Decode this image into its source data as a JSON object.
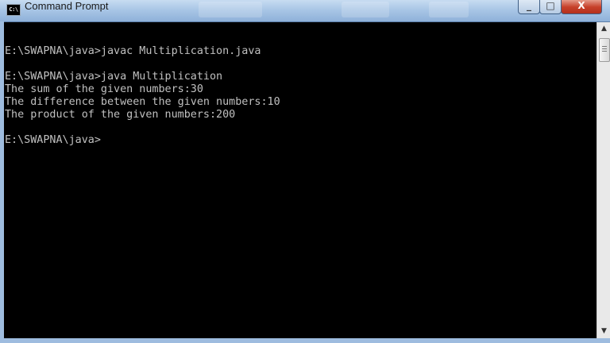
{
  "window": {
    "title": "Command Prompt",
    "icon_text": "C:\\",
    "controls": {
      "minimize_icon": "minimize-icon",
      "maximize_icon": "maximize-icon",
      "close_icon": "close-icon"
    }
  },
  "console": {
    "lines": [
      "",
      "E:\\SWAPNA\\java>javac Multiplication.java",
      "",
      "E:\\SWAPNA\\java>java Multiplication",
      "The sum of the given numbers:30",
      "The difference between the given numbers:10",
      "The product of the given numbers:200",
      "",
      "E:\\SWAPNA\\java>"
    ],
    "text_color": "#c0c0c0",
    "background_color": "#000000"
  },
  "scrollbar": {
    "up_icon": "up-arrow-icon",
    "down_icon": "down-arrow-icon",
    "up_glyph": "▲",
    "down_glyph": "▼",
    "max_glyph": "□",
    "min_glyph": "_",
    "close_glyph": "X"
  }
}
